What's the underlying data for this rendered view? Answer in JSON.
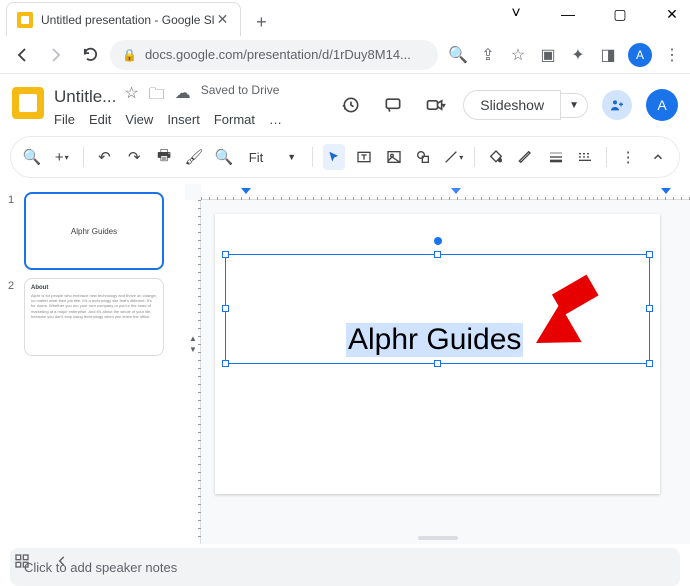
{
  "window": {
    "tab_title": "Untitled presentation - Google Sl",
    "min": "—",
    "max": "▢",
    "close": "✕",
    "down": "˅"
  },
  "browser": {
    "url_text": "docs.google.com/presentation/d/1rDuy8M14...",
    "avatar_letter": "A"
  },
  "app": {
    "title": "Untitle...",
    "saved": "Saved to Drive",
    "menu": {
      "file": "File",
      "edit": "Edit",
      "view": "View",
      "insert": "Insert",
      "format": "Format",
      "more": "…"
    },
    "slideshow": "Slideshow",
    "zoom_label": "Fit"
  },
  "sidebar": {
    "slides": [
      {
        "num": "1",
        "title": "Alphr Guides"
      },
      {
        "num": "2",
        "head": "About",
        "body": "Alphr is for people who embrace new technology and thrive on change, no matter what their job title. It's a technology site that's different. It's for doers. Whether you run your own company or you're the head of marketing at a major enterprise. And it's about the whole of your life, because you don't stop using technology when you leave the office."
      }
    ]
  },
  "canvas": {
    "textbox_text": "Alphr Guides"
  },
  "notes": {
    "placeholder": "Click to add speaker notes"
  }
}
